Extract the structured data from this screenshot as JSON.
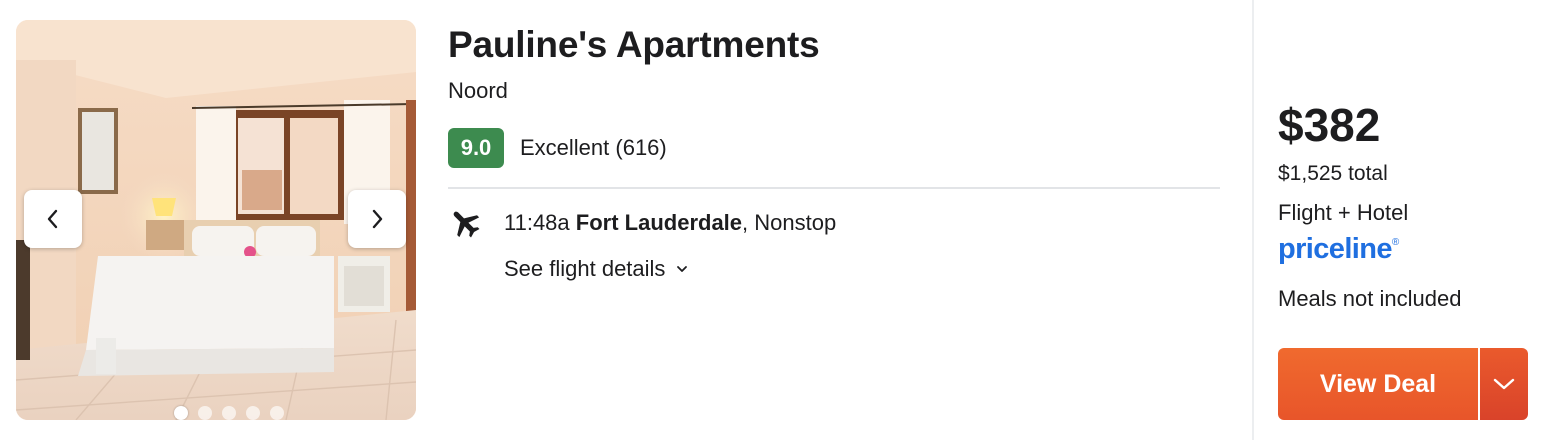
{
  "hotel": {
    "name": "Pauline's Apartments",
    "location": "Noord",
    "score": "9.0",
    "rating_text": "Excellent (616)"
  },
  "gallery": {
    "image_description": "hotel bedroom photo",
    "total_images": 5,
    "active_index": 0
  },
  "flight": {
    "time": "11:48a",
    "origin": "Fort Lauderdale",
    "stops": ", Nonstop",
    "details_label": "See flight details"
  },
  "deal": {
    "price": "$382",
    "total": "$1,525 total",
    "package": "Flight + Hotel",
    "provider": "priceline",
    "provider_mark": "®",
    "meals": "Meals not included",
    "button_label": "View Deal"
  },
  "colors": {
    "score_badge": "#3d8b4f",
    "provider": "#1f6fe0",
    "deal_button": "#f06a2e"
  },
  "icons": {
    "prev": "chevron-left-icon",
    "next": "chevron-right-icon",
    "flight": "airplane-icon",
    "details": "chevron-down-icon",
    "dropdown": "chevron-down-icon"
  }
}
